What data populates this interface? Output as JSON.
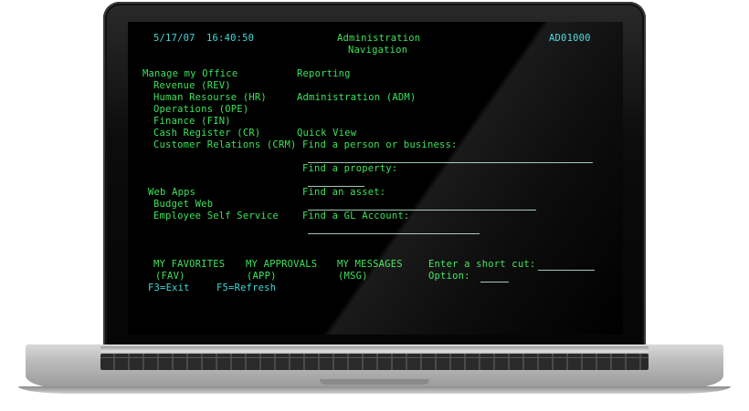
{
  "header": {
    "date": "5/17/07",
    "time": "16:40:50",
    "title_line1": "Administration",
    "title_line2": "Navigation",
    "screen_id": "AD01000"
  },
  "manage_office": {
    "heading": "Manage my Office",
    "items": [
      "Revenue (REV)",
      "Human Resourse (HR)",
      "Operations (OPE)",
      "Finance (FIN)",
      "Cash Register (CR)",
      "Customer Relations (CRM)"
    ]
  },
  "reporting": {
    "heading": "Reporting",
    "admin": "Administration (ADM)"
  },
  "quick_view": {
    "heading": "Quick View",
    "find_person": "Find a person or business:",
    "find_property": "Find a property:",
    "find_asset": "Find an asset:",
    "find_gl": "Find a GL Account:"
  },
  "web_apps": {
    "heading": "Web Apps",
    "items": [
      "Budget Web",
      "Employee Self Service"
    ]
  },
  "bottom": {
    "fav_label": "MY FAVORITES",
    "fav_code": "(FAV)",
    "app_label": "MY APPROVALS",
    "app_code": "(APP)",
    "msg_label": "MY MESSAGES",
    "msg_code": "(MSG)",
    "shortcut_label": "Enter a short cut:",
    "option_label": "Option:"
  },
  "function_keys": {
    "exit": "F3=Exit",
    "refresh": "F5=Refresh"
  },
  "colors": {
    "terminal_green": "#3be35a",
    "terminal_cyan": "#3fd8d8",
    "screen_bg": "#000000"
  }
}
